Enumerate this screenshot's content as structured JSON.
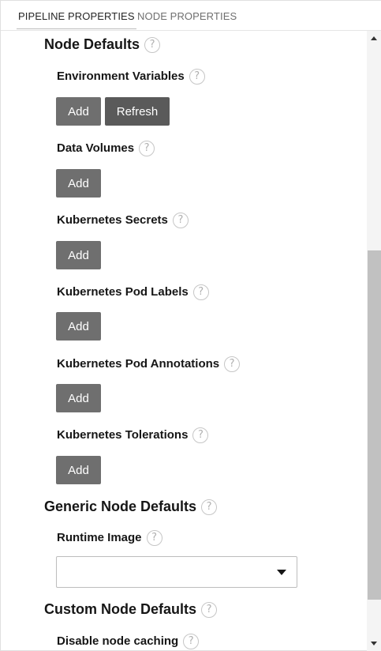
{
  "tabs": {
    "pipeline_properties": "PIPELINE PROPERTIES",
    "node_properties": "NODE PROPERTIES",
    "active": "pipeline_properties"
  },
  "sections": {
    "node_defaults": {
      "title": "Node Defaults",
      "environment_variables": {
        "label": "Environment Variables",
        "add": "Add",
        "refresh": "Refresh"
      },
      "data_volumes": {
        "label": "Data Volumes",
        "add": "Add"
      },
      "kubernetes_secrets": {
        "label": "Kubernetes Secrets",
        "add": "Add"
      },
      "kubernetes_pod_labels": {
        "label": "Kubernetes Pod Labels",
        "add": "Add"
      },
      "kubernetes_pod_annotations": {
        "label": "Kubernetes Pod Annotations",
        "add": "Add"
      },
      "kubernetes_tolerations": {
        "label": "Kubernetes Tolerations",
        "add": "Add"
      }
    },
    "generic_node_defaults": {
      "title": "Generic Node Defaults",
      "runtime_image": {
        "label": "Runtime Image",
        "value": ""
      }
    },
    "custom_node_defaults": {
      "title": "Custom Node Defaults",
      "disable_node_caching": {
        "label": "Disable node caching"
      }
    }
  },
  "help_glyph": "?",
  "icons": {
    "help": "help-icon",
    "dropdown": "chevron-down-icon",
    "scroll_up": "scroll-up-icon",
    "scroll_down": "scroll-down-icon"
  },
  "colors": {
    "button_bg": "#6f6f6f",
    "button_bg_dark": "#5a5a5a",
    "button_text": "#ffffff",
    "heading_text": "#161616",
    "tab_inactive": "#6f6f6f",
    "scrollbar_thumb": "#c1c1c1"
  }
}
